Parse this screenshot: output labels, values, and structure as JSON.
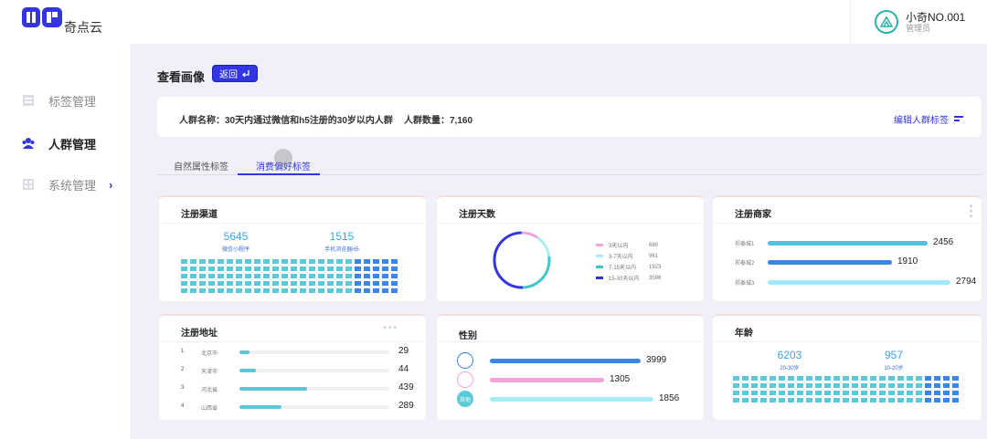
{
  "brand": {
    "logo_text": "奇点云"
  },
  "sidebar": {
    "items": [
      {
        "label": "标签管理",
        "icon": "tag-grid-icon"
      },
      {
        "label": "人群管理",
        "icon": "people-icon"
      },
      {
        "label": "系统管理",
        "icon": "system-grid-icon",
        "arrow": "›"
      }
    ]
  },
  "user": {
    "name": "小奇NO.001",
    "role": "管理员"
  },
  "page": {
    "title": "查看画像",
    "back_label": "返回"
  },
  "info": {
    "crowd_name": "人群名称：30天内通过微信和h5注册的30岁以内人群",
    "crowd_count": "人群数量：7,160",
    "edit_label": "编辑人群标签"
  },
  "tabs": [
    {
      "label": "自然属性标签"
    },
    {
      "label": "消费偏好标签",
      "active": true
    }
  ],
  "cards": {
    "channel": {
      "title": "注册渠道",
      "stats": [
        {
          "value": "5645",
          "caption": "微信小程序"
        },
        {
          "value": "1515",
          "caption": "手机浏览器H5"
        }
      ],
      "accent": "#5bc9d8"
    },
    "days": {
      "title": "注册天数",
      "legend": [
        {
          "label": "3天以内",
          "value": "680",
          "color": "#f3a3d8"
        },
        {
          "label": "3-7天以内",
          "value": "961",
          "color": "#a8ecf5"
        },
        {
          "label": "7-15天以内",
          "value": "1923",
          "color": "#3ec9c9"
        },
        {
          "label": "15-30天以内",
          "value": "3596",
          "color": "#3336e0"
        }
      ]
    },
    "merchant": {
      "title": "注册商家",
      "rows": [
        {
          "label": "祁泰城1",
          "value": "2456",
          "fraction": 0.71,
          "color": "#4ec3dc"
        },
        {
          "label": "祁泰城2",
          "value": "1910",
          "fraction": 0.55,
          "color": "#3a86e8"
        },
        {
          "label": "祁泰城3",
          "value": "2794",
          "fraction": 0.81,
          "color": "#9fe7f4"
        }
      ]
    },
    "region": {
      "title": "注册地址",
      "rows": [
        {
          "idx": "1",
          "name": "北京市",
          "value": "29",
          "fraction": 0.07
        },
        {
          "idx": "2",
          "name": "天津市",
          "value": "44",
          "fraction": 0.11
        },
        {
          "idx": "3",
          "name": "河北省",
          "value": "439",
          "fraction": 0.45
        },
        {
          "idx": "4",
          "name": "山西省",
          "value": "289",
          "fraction": 0.28
        }
      ]
    },
    "gender": {
      "title": "性别",
      "rows": [
        {
          "icon": "male-icon",
          "value": "3999",
          "fraction": 0.87,
          "color": "#3a86e8",
          "iconcolor": "#3a86e8",
          "glyph": ""
        },
        {
          "icon": "female-icon",
          "value": "1305",
          "fraction": 0.66,
          "color": "#f3a3d8",
          "iconcolor": "#f3a3d8",
          "glyph": ""
        },
        {
          "icon": "unknown-icon",
          "value": "1856",
          "fraction": 0.94,
          "color": "#a8ecf5",
          "iconcolor": "#5bc9d8",
          "glyph": "其他"
        }
      ]
    },
    "age": {
      "title": "年龄",
      "stats": [
        {
          "value": "6203",
          "caption": "20-30岁"
        },
        {
          "value": "957",
          "caption": "10-20岁"
        }
      ],
      "accent": "#3a86e8"
    }
  }
}
